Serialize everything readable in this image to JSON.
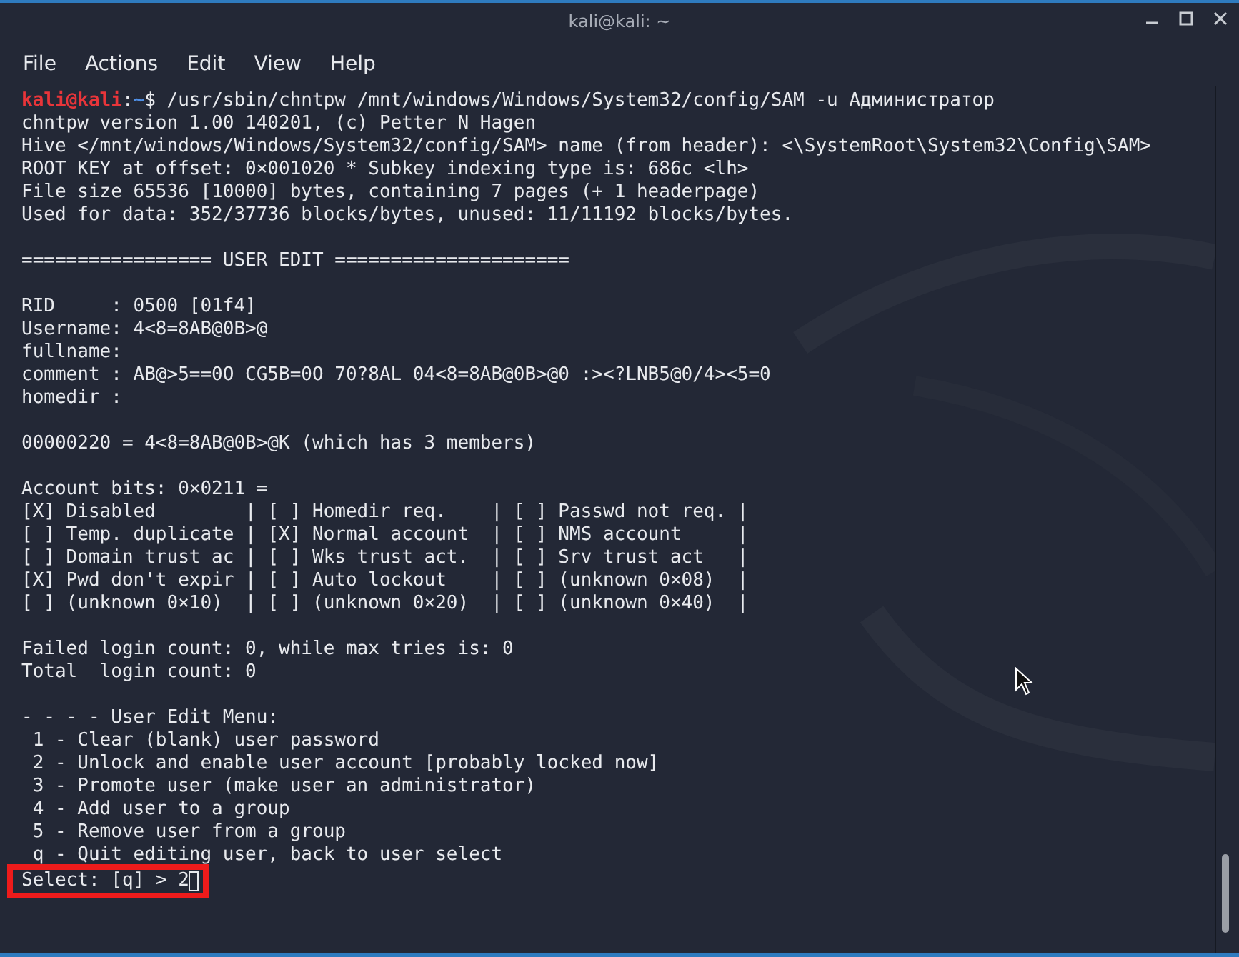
{
  "window": {
    "title": "kali@kali: ~"
  },
  "menu": [
    {
      "label": "File"
    },
    {
      "label": "Actions"
    },
    {
      "label": "Edit"
    },
    {
      "label": "View"
    },
    {
      "label": "Help"
    }
  ],
  "terminal": {
    "prompt": {
      "user_host": "kali@kali",
      "separator": ":",
      "path": "~",
      "symbol": "$",
      "command": " /usr/sbin/chntpw /mnt/windows/Windows/System32/config/SAM -u Администратор"
    },
    "blocks": [
      [
        "chntpw version 1.00 140201, (c) Petter N Hagen",
        "Hive </mnt/windows/Windows/System32/config/SAM> name (from header): <\\SystemRoot\\System32\\Config\\SAM>",
        "ROOT KEY at offset: 0×001020 * Subkey indexing type is: 686c <lh>",
        "File size 65536 [10000] bytes, containing 7 pages (+ 1 headerpage)",
        "Used for data: 352/37736 blocks/bytes, unused: 11/11192 blocks/bytes."
      ],
      [
        "================= USER EDIT ====================="
      ],
      [
        "RID     : 0500 [01f4]",
        "Username: 4<8=8AB@0B>@",
        "fullname:",
        "comment : AB@>5==0O CG5B=0O 70?8AL 04<8=8AB@0B>@0 :><?LNB5@0/4><5=0",
        "homedir :"
      ],
      [
        "00000220 = 4<8=8AB@0B>@K (which has 3 members)"
      ],
      [
        "Account bits: 0×0211 =",
        "[X] Disabled        | [ ] Homedir req.    | [ ] Passwd not req. |",
        "[ ] Temp. duplicate | [X] Normal account  | [ ] NMS account     |",
        "[ ] Domain trust ac | [ ] Wks trust act.  | [ ] Srv trust act   |",
        "[X] Pwd don't expir | [ ] Auto lockout    | [ ] (unknown 0×08)  |",
        "[ ] (unknown 0×10)  | [ ] (unknown 0×20)  | [ ] (unknown 0×40)  |"
      ],
      [
        "Failed login count: 0, while max tries is: 0",
        "Total  login count: 0"
      ],
      [
        "- - - - User Edit Menu:",
        " 1 - Clear (blank) user password",
        " 2 - Unlock and enable user account [probably locked now]",
        " 3 - Promote user (make user an administrator)",
        " 4 - Add user to a group",
        " 5 - Remove user from a group",
        " q - Quit editing user, back to user select"
      ]
    ],
    "input": {
      "prompt": "Select: [q] > ",
      "value": "2",
      "highlighted": true,
      "cursor": true
    }
  }
}
